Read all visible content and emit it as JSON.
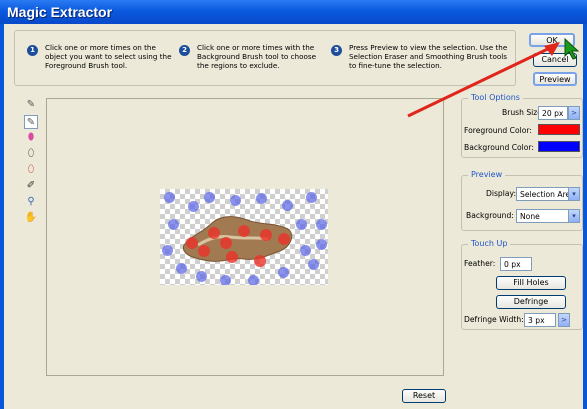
{
  "window": {
    "title": "Magic Extractor"
  },
  "steps": [
    {
      "num": "1",
      "text": "Click one or more times on the object you want to select using the Foreground Brush tool."
    },
    {
      "num": "2",
      "text": "Click one or more times with the Background Brush tool to choose the regions to exclude."
    },
    {
      "num": "3",
      "text": "Press Preview to view the selection. Use the Selection Eraser and Smoothing Brush tools to fine-tune the selection."
    }
  ],
  "buttons": {
    "ok": "OK",
    "cancel": "Cancel",
    "preview": "Preview",
    "reset": "Reset",
    "fill_holes": "Fill Holes",
    "defringe": "Defringe"
  },
  "tools": [
    "foreground-brush-icon",
    "background-brush-icon",
    "point-eraser-icon",
    "add-to-selection-icon",
    "smoothing-brush-icon",
    "selection-eraser-icon",
    "zoom-icon",
    "hand-icon"
  ],
  "tool_options": {
    "legend": "Tool Options",
    "brush_size_label": "Brush Size:",
    "brush_size_value": "20 px",
    "fg_label": "Foreground Color:",
    "fg_color": "#ff0000",
    "bg_label": "Background Color:",
    "bg_color": "#0000ff"
  },
  "preview": {
    "legend": "Preview",
    "display_label": "Display:",
    "display_value": "Selection Area",
    "background_label": "Background:",
    "background_value": "None"
  },
  "touch_up": {
    "legend": "Touch Up",
    "feather_label": "Feather:",
    "feather_value": "0 px",
    "defringe_width_label": "Defringe Width:",
    "defringe_width_value": "3 px"
  },
  "colors": {
    "accent_arrow": "#e0251b",
    "title_bar": "#0a5adf",
    "cursor": "#1a9a1a"
  }
}
